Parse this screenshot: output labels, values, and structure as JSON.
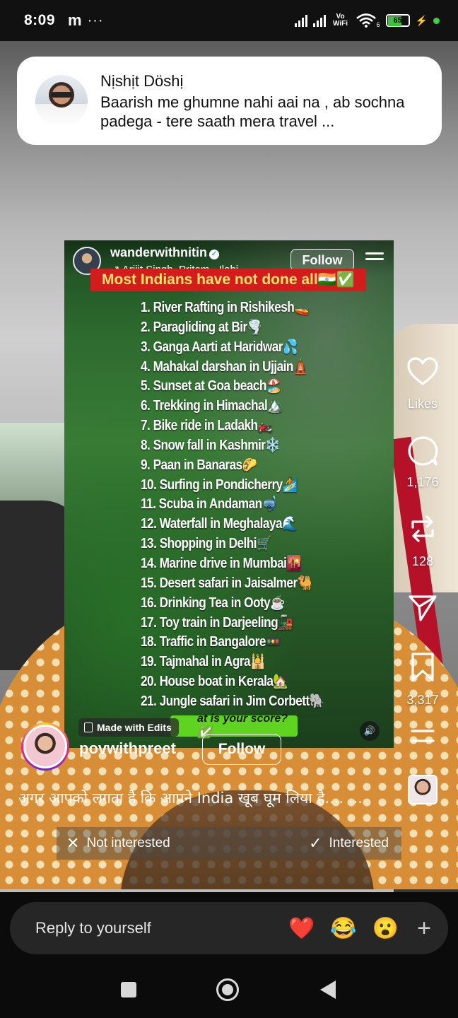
{
  "status_bar": {
    "time": "8:09",
    "carrier_icon": "m",
    "more": "···",
    "vowifi": "Vo WiFi",
    "wifi_sub": "6",
    "battery": "65"
  },
  "notification": {
    "sender": "Nịshịt Döshị",
    "message": "Baarish me ghumne nahi aai na , ab sochna padega - tere saath mera travel ..."
  },
  "post": {
    "username": "wanderwithnitin",
    "music": "↗ Arijit Singh, Pritam · Ilahi",
    "follow_label": "Follow",
    "banner": "Most Indians have not done all🇮🇳✅",
    "list": [
      {
        "text": "1. River Rafting in Rishikesh",
        "emoji": "🚤"
      },
      {
        "text": "2. Paragliding at Bir",
        "emoji": "🌪️"
      },
      {
        "text": "3. Ganga Aarti at Haridwar",
        "emoji": "💦"
      },
      {
        "text": "4. Mahakal darshan in Ujjain",
        "emoji": "🛕"
      },
      {
        "text": "5. Sunset at Goa beach",
        "emoji": "🏖️"
      },
      {
        "text": "6. Trekking in Himachal",
        "emoji": "🏔️"
      },
      {
        "text": "7. Bike ride in Ladakh",
        "emoji": "🏍️"
      },
      {
        "text": "8. Snow fall in Kashmir",
        "emoji": "❄️"
      },
      {
        "text": "9. Paan in Banaras",
        "emoji": "🌮"
      },
      {
        "text": "10. Surfing in Pondicherry",
        "emoji": "🏄"
      },
      {
        "text": "11. Scuba in Andaman",
        "emoji": "🤿"
      },
      {
        "text": "12. Waterfall in Meghalaya",
        "emoji": "🌊"
      },
      {
        "text": "13. Shopping in Delhi",
        "emoji": "🛒"
      },
      {
        "text": "14. Marine drive in Mumbai",
        "emoji": "🌇"
      },
      {
        "text": "15. Desert safari in Jaisalmer",
        "emoji": "🐫"
      },
      {
        "text": "16. Drinking Tea in Ooty",
        "emoji": "☕"
      },
      {
        "text": "17. Toy train in Darjeeling",
        "emoji": "🚂"
      },
      {
        "text": "18. Traffic in Bangalore",
        "emoji": "🚥"
      },
      {
        "text": "19. Tajmahal in Agra",
        "emoji": "🕌"
      },
      {
        "text": "20. House boat in Kerala",
        "emoji": "🏡"
      },
      {
        "text": "21. Jungle safari in Jim Corbett",
        "emoji": "🐘"
      }
    ],
    "score_text": "at is your score?✅",
    "made_with": "Made with Edits"
  },
  "rail": {
    "likes_label": "Likes",
    "comments": "1,176",
    "reposts": "128",
    "saves": "3,317"
  },
  "story": {
    "author": "povwithpreet",
    "follow_label": "Follow",
    "caption": "अगर आपको लगता है कि आपने India खूब घूम लिया है.... ...",
    "not_interested": "Not interested",
    "interested": "Interested"
  },
  "reply": {
    "placeholder": "Reply to yourself",
    "emojis": [
      "❤️",
      "😂",
      "😮"
    ],
    "plus": "+"
  }
}
